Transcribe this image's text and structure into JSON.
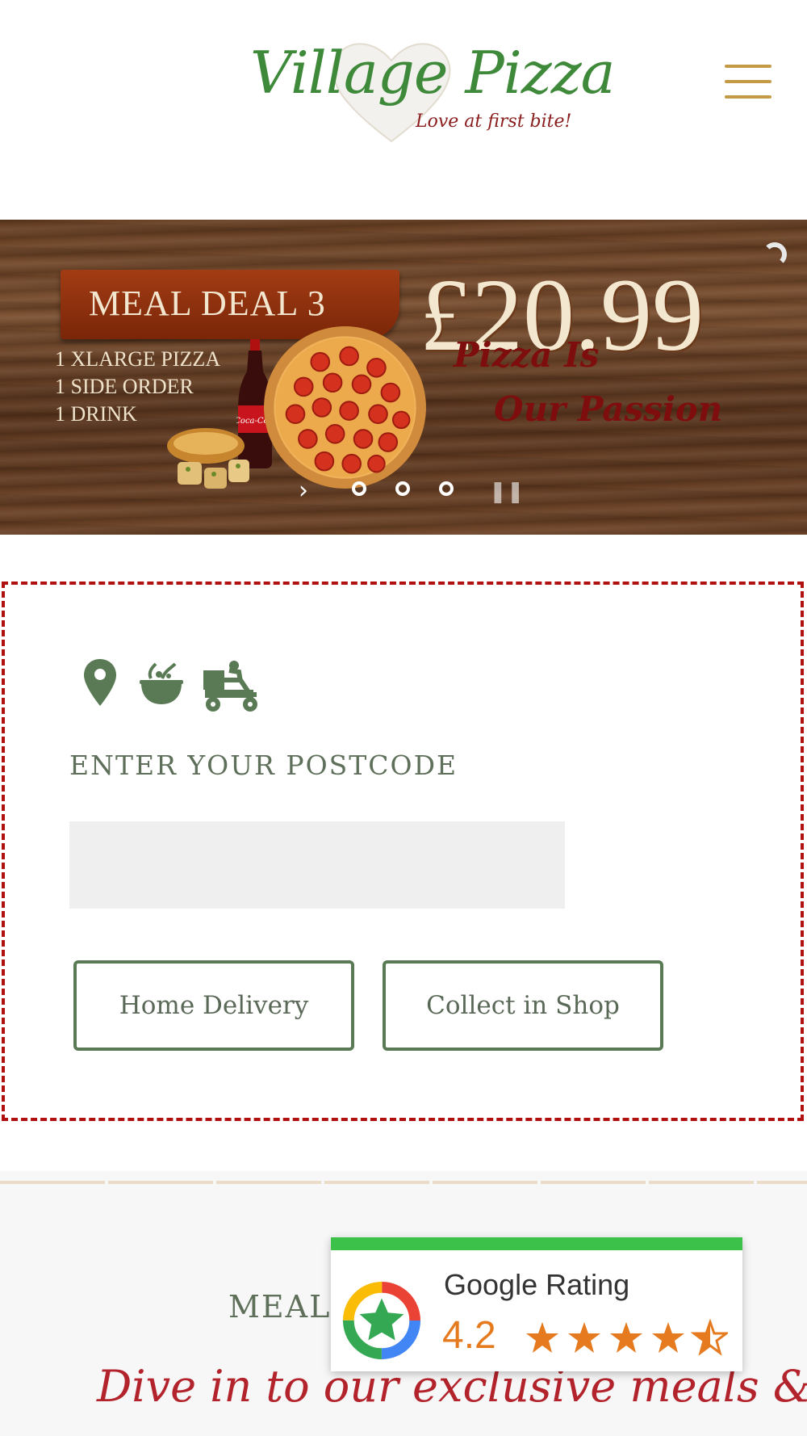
{
  "header": {
    "logo_title": "Village Pizza",
    "logo_tagline": "Love at first bite!"
  },
  "banner": {
    "deal_title": "MEAL DEAL 3",
    "deal_items": [
      "1 XLARGE PIZZA",
      "1 SIDE ORDER",
      "1 DRINK"
    ],
    "price": "£20.99",
    "slogan_line1": "Pizza Is",
    "slogan_line2": "Our Passion",
    "bottle_brand": "Coca-Cola",
    "slide_count": 3,
    "active_slide": 0
  },
  "order": {
    "icons": [
      "location-pin-icon",
      "food-bowl-icon",
      "delivery-scooter-icon"
    ],
    "postcode_label": "ENTER YOUR POSTCODE",
    "postcode_value": "",
    "postcode_placeholder": "",
    "home_delivery_label": "Home Delivery",
    "collect_label": "Collect in Shop"
  },
  "meals": {
    "heading": "MEALS",
    "subheading": "Dive in to our exclusive meals &"
  },
  "rating": {
    "title": "Google Rating",
    "score": "4.2",
    "stars": 4.5
  },
  "colors": {
    "accent_green": "#5a7a55",
    "dashed_border": "#b01010",
    "menu_gold": "#c39a45",
    "rating_bar": "#3cc24a",
    "star_orange": "#e57a1f",
    "script_red": "#b3232b"
  }
}
